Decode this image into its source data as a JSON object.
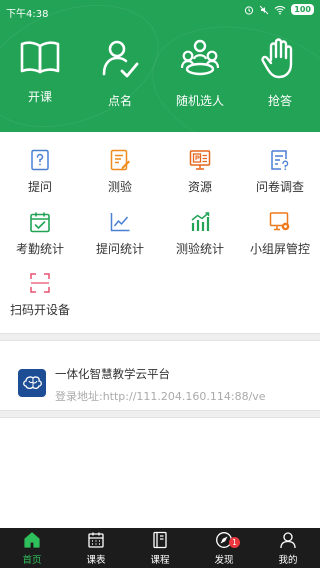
{
  "status_bar": {
    "time": "下午4:38",
    "battery": "100"
  },
  "header": {
    "items": [
      {
        "label": "开课",
        "icon": "book-icon"
      },
      {
        "label": "点名",
        "icon": "user-check-icon"
      },
      {
        "label": "随机选人",
        "icon": "group-icon"
      },
      {
        "label": "抢答",
        "icon": "raise-hand-icon"
      }
    ]
  },
  "grid": {
    "items": [
      {
        "label": "提问",
        "icon": "question-doc-icon",
        "color": "#4a7fd4"
      },
      {
        "label": "测验",
        "icon": "quiz-doc-icon",
        "color": "#ef8a1d"
      },
      {
        "label": "资源",
        "icon": "ppt-icon",
        "color": "#e5671e"
      },
      {
        "label": "问卷调查",
        "icon": "survey-icon",
        "color": "#4a7fd4"
      },
      {
        "label": "考勤统计",
        "icon": "calendar-check-icon",
        "color": "#22a356"
      },
      {
        "label": "提问统计",
        "icon": "line-chart-icon",
        "color": "#4a7fd4"
      },
      {
        "label": "测验统计",
        "icon": "bar-chart-icon",
        "color": "#22a356"
      },
      {
        "label": "小组屏管控",
        "icon": "screen-gear-icon",
        "color": "#ef7a1d"
      },
      {
        "label": "扫码开设备",
        "icon": "scan-icon",
        "color": "#e8506e"
      }
    ]
  },
  "platform": {
    "title": "一体化智慧教学云平台",
    "url": "登录地址:http://111.204.160.114:88/ve"
  },
  "bottom_nav": {
    "items": [
      {
        "label": "首页",
        "icon": "home-icon",
        "active": true
      },
      {
        "label": "课表",
        "icon": "schedule-icon",
        "active": false
      },
      {
        "label": "课程",
        "icon": "course-icon",
        "active": false
      },
      {
        "label": "发现",
        "icon": "discover-icon",
        "active": false,
        "badge": "1"
      },
      {
        "label": "我的",
        "icon": "profile-icon",
        "active": false
      }
    ]
  }
}
